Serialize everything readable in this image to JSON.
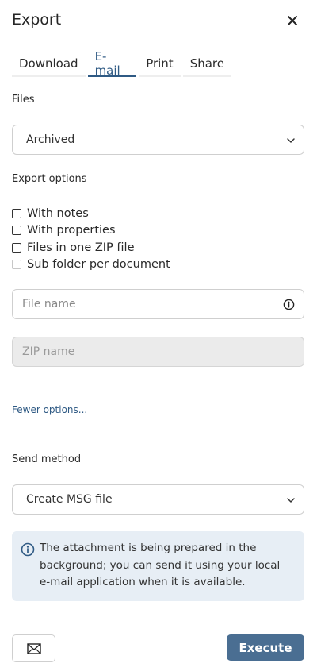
{
  "header": {
    "title": "Export"
  },
  "tabs": [
    {
      "label": "Download"
    },
    {
      "label": "E-mail"
    },
    {
      "label": "Print"
    },
    {
      "label": "Share"
    }
  ],
  "active_tab": "E-mail",
  "files": {
    "label": "Files",
    "value": "Archived"
  },
  "export_options": {
    "label": "Export options",
    "checkboxes": [
      {
        "label": "With notes",
        "checked": false,
        "disabled": false
      },
      {
        "label": "With properties",
        "checked": false,
        "disabled": false
      },
      {
        "label": "Files in one ZIP file",
        "checked": false,
        "disabled": false
      },
      {
        "label": "Sub folder per document",
        "checked": false,
        "disabled": true
      }
    ]
  },
  "file_name": {
    "placeholder": "File name",
    "value": ""
  },
  "zip_name": {
    "placeholder": "ZIP name",
    "value": "",
    "disabled": true
  },
  "fewer_options": "Fewer options...",
  "send_method": {
    "label": "Send method",
    "value": "Create MSG file"
  },
  "notice": {
    "text": "The attachment is being prepared in the background; you can send it using your local e-mail application when it is available."
  },
  "footer": {
    "execute_label": "Execute"
  },
  "colors": {
    "accent": "#2f5a84",
    "button": "#4a6e92",
    "notice_bg": "#e7eef5"
  }
}
